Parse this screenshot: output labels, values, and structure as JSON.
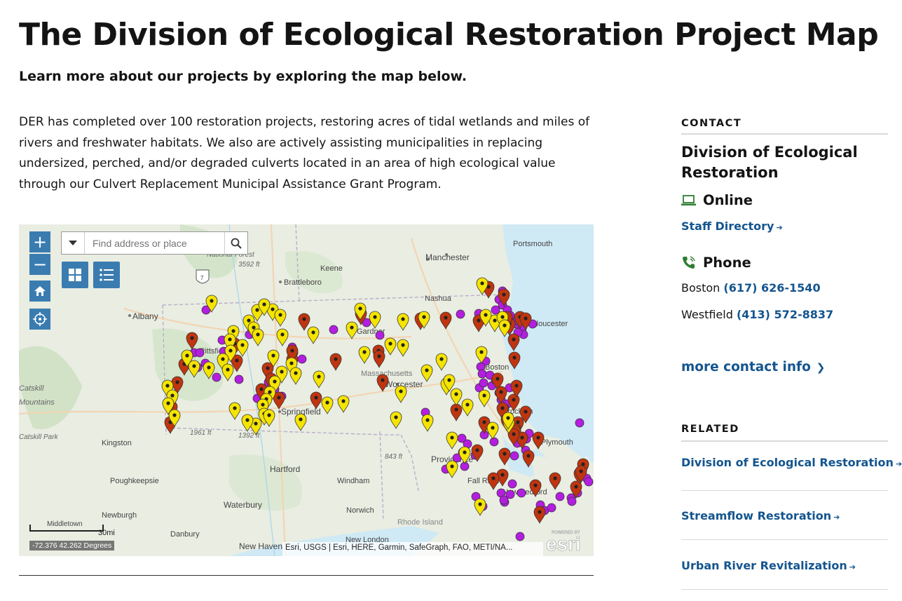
{
  "page": {
    "title": "The Division of Ecological Restoration Project Map",
    "lead": "Learn more about our projects by exploring the map below.",
    "intro": "DER has completed over 100 restoration projects, restoring acres of tidal wetlands and miles of rivers and freshwater habitats. We also are actively assisting municipalities in replacing undersized, perched, and/or degraded culverts located in an area of high ecological value through our Culvert Replacement Municipal Assistance Grant Program."
  },
  "map": {
    "search_placeholder": "Find address or place",
    "zoom_in": "+",
    "zoom_out": "−",
    "scale_label": "30mi",
    "coordinates": "-72.376 42.262 Degrees",
    "attribution": "Esri, USGS | Esri, HERE, Garmin, SafeGraph, FAO, METI/NA...",
    "powered_by": "POWERED BY",
    "esri": "esri",
    "colors": {
      "water": "#cfe9f5",
      "land": "#e9ede2",
      "yellow_marker": "#f5e400",
      "red_marker": "#c0350f",
      "purple_marker": "#b41ee0",
      "widget": "#3a7cb0"
    },
    "labels": {
      "national_forest": "National Forest",
      "elev_3592": "3592 ft",
      "portsmouth": "Portsmouth",
      "manchester": "Manchester",
      "keene": "Keene",
      "brattleboro": "Brattleboro",
      "nashua": "Nashua",
      "gloucester": "Gloucester",
      "albany": "Albany",
      "pittsfield": "Pittsfield",
      "gardner": "Gardner",
      "boston": "Boston",
      "massachusetts": "Massachusetts",
      "worcester": "Worcester",
      "catskill": "Catskill",
      "mountains": "Mountains",
      "springfield": "Springfield",
      "brockton": "Brockton",
      "elev_1961": "1961 ft",
      "elev_1392": "1392 ft",
      "kingston": "Kingston",
      "skill_park": "Catskill Park",
      "plymouth": "Plymouth",
      "elev_843": "843 ft",
      "providence": "Providence",
      "hartford": "Hartford",
      "poughkeepsie": "Poughkeepsie",
      "windham": "Windham",
      "fall_river": "Fall River",
      "new_bedford": "New Bedford",
      "waterbury": "Waterbury",
      "newburgh": "Newburgh",
      "norwich": "Norwich",
      "rhode_island": "Rhode Island",
      "middletown": "Middletown",
      "danbury": "Danbury",
      "new_london": "New London",
      "new_haven": "New Haven",
      "route_7": "7"
    }
  },
  "sidebar": {
    "contact_heading": "CONTACT",
    "org_name": "Division of Ecological Restoration",
    "online_label": "Online",
    "staff_directory": "Staff Directory",
    "phone_label": "Phone",
    "phones": [
      {
        "place": "Boston",
        "number": "(617) 626-1540"
      },
      {
        "place": "Westfield",
        "number": "(413) 572-8837"
      }
    ],
    "more_contact": "more contact info",
    "related_heading": "RELATED",
    "related": [
      "Division of Ecological Restoration",
      "Streamflow Restoration",
      "Urban River Revitalization"
    ]
  }
}
